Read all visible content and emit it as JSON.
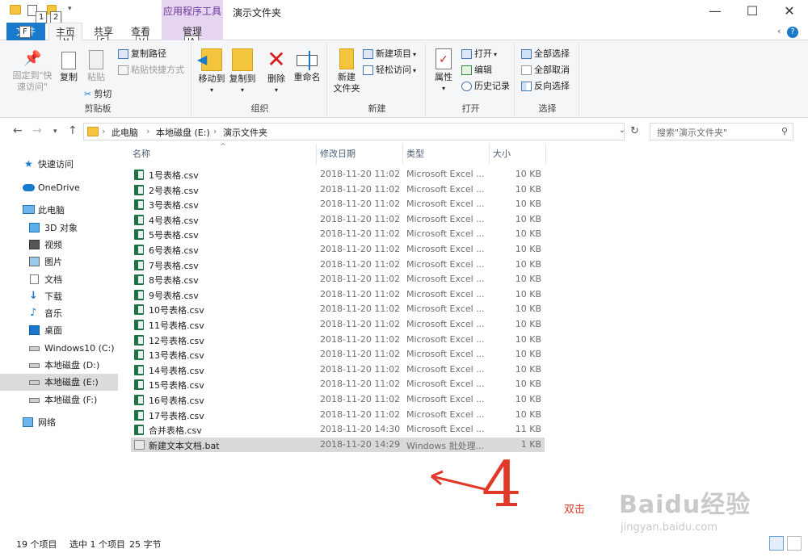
{
  "titlebar": {
    "contextual_tab_header": "应用程序工具",
    "title": "演示文件夹",
    "keytips": [
      "1",
      "2"
    ]
  },
  "ribbon_tabs": {
    "file": "文件",
    "file_keytip": "F",
    "home": "主页",
    "home_keytip": "H",
    "share": "共享",
    "share_keytip": "S",
    "view": "查看",
    "view_keytip": "V",
    "manage": "管理",
    "manage_keytip": "JA"
  },
  "ribbon": {
    "clipboard": {
      "label": "剪贴板",
      "pin": "固定到\"快速访问\"",
      "copy": "复制",
      "paste": "粘贴",
      "copy_path": "复制路径",
      "paste_shortcut": "粘贴快捷方式",
      "cut": "剪切"
    },
    "organize": {
      "label": "组织",
      "move_to": "移动到",
      "copy_to": "复制到",
      "delete": "删除",
      "rename": "重命名"
    },
    "new": {
      "label": "新建",
      "new_folder": "新建\n文件夹",
      "new_item": "新建项目",
      "easy_access": "轻松访问"
    },
    "open": {
      "label": "打开",
      "properties": "属性",
      "open": "打开",
      "edit": "编辑",
      "history": "历史记录"
    },
    "select": {
      "label": "选择",
      "select_all": "全部选择",
      "select_none": "全部取消",
      "invert": "反向选择"
    }
  },
  "address": {
    "crumbs": [
      "此电脑",
      "本地磁盘 (E:)",
      "演示文件夹"
    ],
    "search_placeholder": "搜索\"演示文件夹\""
  },
  "nav": [
    {
      "label": "快速访问",
      "icon": "star-icon"
    },
    {
      "label": "OneDrive",
      "icon": "cloud-icon"
    },
    {
      "label": "此电脑",
      "icon": "computer-icon"
    },
    {
      "label": "3D 对象",
      "icon": "cube-icon"
    },
    {
      "label": "视频",
      "icon": "video-icon"
    },
    {
      "label": "图片",
      "icon": "picture-icon"
    },
    {
      "label": "文档",
      "icon": "document-icon"
    },
    {
      "label": "下载",
      "icon": "download-icon"
    },
    {
      "label": "音乐",
      "icon": "music-icon"
    },
    {
      "label": "桌面",
      "icon": "desktop-icon"
    },
    {
      "label": "Windows10 (C:)",
      "icon": "drive-icon"
    },
    {
      "label": "本地磁盘 (D:)",
      "icon": "drive-icon"
    },
    {
      "label": "本地磁盘 (E:)",
      "icon": "drive-icon",
      "selected": true
    },
    {
      "label": "本地磁盘 (F:)",
      "icon": "drive-icon"
    },
    {
      "label": "网络",
      "icon": "network-icon"
    }
  ],
  "columns": {
    "name": "名称",
    "date": "修改日期",
    "type": "类型",
    "size": "大小"
  },
  "files": [
    {
      "name": "1号表格.csv",
      "date": "2018-11-20 11:02",
      "type": "Microsoft Excel ...",
      "size": "10 KB",
      "kind": "csv"
    },
    {
      "name": "2号表格.csv",
      "date": "2018-11-20 11:02",
      "type": "Microsoft Excel ...",
      "size": "10 KB",
      "kind": "csv"
    },
    {
      "name": "3号表格.csv",
      "date": "2018-11-20 11:02",
      "type": "Microsoft Excel ...",
      "size": "10 KB",
      "kind": "csv"
    },
    {
      "name": "4号表格.csv",
      "date": "2018-11-20 11:02",
      "type": "Microsoft Excel ...",
      "size": "10 KB",
      "kind": "csv"
    },
    {
      "name": "5号表格.csv",
      "date": "2018-11-20 11:02",
      "type": "Microsoft Excel ...",
      "size": "10 KB",
      "kind": "csv"
    },
    {
      "name": "6号表格.csv",
      "date": "2018-11-20 11:02",
      "type": "Microsoft Excel ...",
      "size": "10 KB",
      "kind": "csv"
    },
    {
      "name": "7号表格.csv",
      "date": "2018-11-20 11:02",
      "type": "Microsoft Excel ...",
      "size": "10 KB",
      "kind": "csv"
    },
    {
      "name": "8号表格.csv",
      "date": "2018-11-20 11:02",
      "type": "Microsoft Excel ...",
      "size": "10 KB",
      "kind": "csv"
    },
    {
      "name": "9号表格.csv",
      "date": "2018-11-20 11:02",
      "type": "Microsoft Excel ...",
      "size": "10 KB",
      "kind": "csv"
    },
    {
      "name": "10号表格.csv",
      "date": "2018-11-20 11:02",
      "type": "Microsoft Excel ...",
      "size": "10 KB",
      "kind": "csv"
    },
    {
      "name": "11号表格.csv",
      "date": "2018-11-20 11:02",
      "type": "Microsoft Excel ...",
      "size": "10 KB",
      "kind": "csv"
    },
    {
      "name": "12号表格.csv",
      "date": "2018-11-20 11:02",
      "type": "Microsoft Excel ...",
      "size": "10 KB",
      "kind": "csv"
    },
    {
      "name": "13号表格.csv",
      "date": "2018-11-20 11:02",
      "type": "Microsoft Excel ...",
      "size": "10 KB",
      "kind": "csv"
    },
    {
      "name": "14号表格.csv",
      "date": "2018-11-20 11:02",
      "type": "Microsoft Excel ...",
      "size": "10 KB",
      "kind": "csv"
    },
    {
      "name": "15号表格.csv",
      "date": "2018-11-20 11:02",
      "type": "Microsoft Excel ...",
      "size": "10 KB",
      "kind": "csv"
    },
    {
      "name": "16号表格.csv",
      "date": "2018-11-20 11:02",
      "type": "Microsoft Excel ...",
      "size": "10 KB",
      "kind": "csv"
    },
    {
      "name": "17号表格.csv",
      "date": "2018-11-20 11:02",
      "type": "Microsoft Excel ...",
      "size": "10 KB",
      "kind": "csv"
    },
    {
      "name": "合并表格.csv",
      "date": "2018-11-20 14:30",
      "type": "Microsoft Excel ...",
      "size": "11 KB",
      "kind": "csv"
    },
    {
      "name": "新建文本文档.bat",
      "date": "2018-11-20 14:29",
      "type": "Windows 批处理...",
      "size": "1 KB",
      "kind": "bat",
      "selected": true
    }
  ],
  "status": {
    "count": "19 个项目",
    "selected": "选中 1 个项目",
    "size": "25 字节"
  },
  "annotation": {
    "number": "4",
    "text": "双击",
    "color": "#e0392a"
  },
  "watermark": {
    "main": "Baidu经验",
    "sub": "jingyan.baidu.com"
  },
  "colors": {
    "file_tab": "#1979ca",
    "context_tab": "#e5d5f0",
    "selection": "#d9d9d9",
    "excel_green": "#1f7244",
    "folder_yellow": "#f3c53c"
  }
}
